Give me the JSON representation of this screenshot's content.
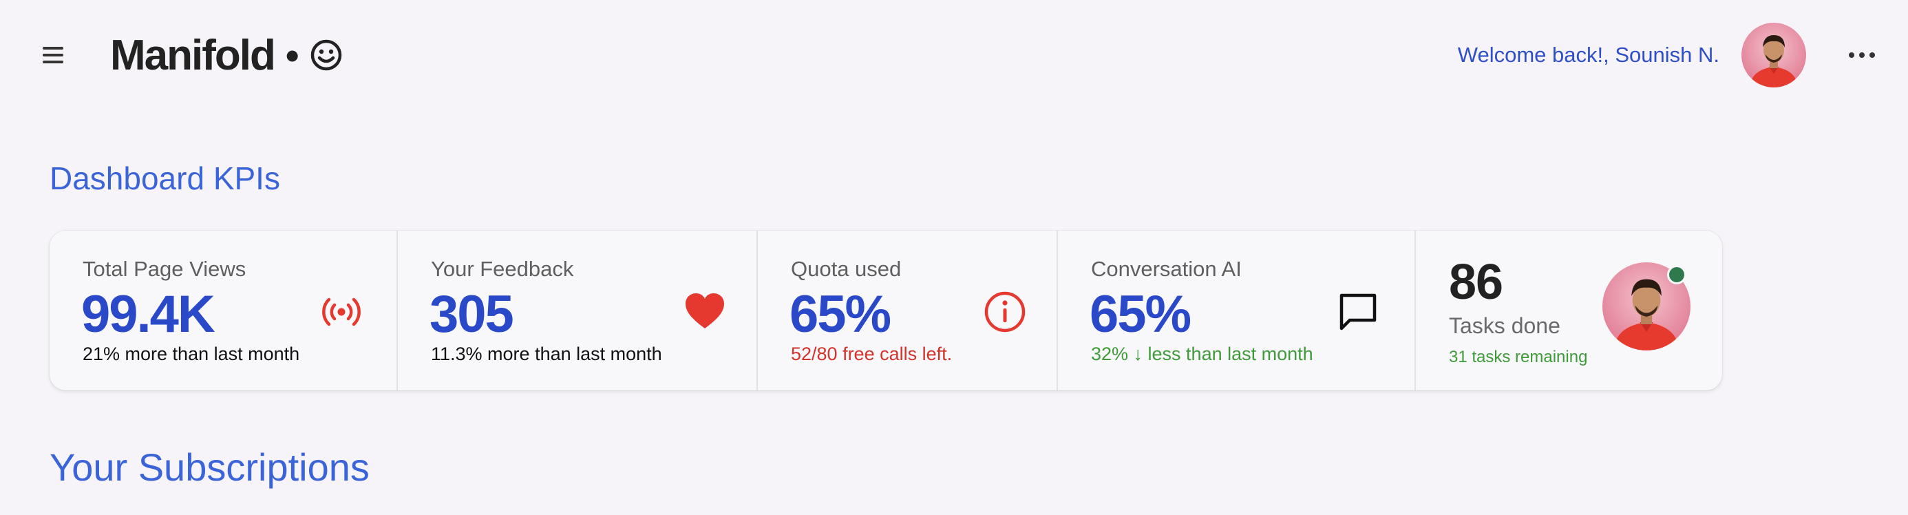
{
  "header": {
    "brand": "Manifold",
    "brand_separator": "•",
    "brand_icon": "smiley-icon",
    "welcome_text": "Welcome back!, Sounish N.",
    "menu_icon": "hamburger-menu-icon",
    "more_icon": "more-horizontal-icon"
  },
  "sections": {
    "kpi_title": "Dashboard KPIs",
    "subscriptions_title": "Your Subscriptions"
  },
  "kpis": [
    {
      "label": "Total Page Views",
      "value": "99.4K",
      "sub": "21% more than last month",
      "icon": "broadcast-icon",
      "icon_color": "#e5392f",
      "sub_color": "#111111"
    },
    {
      "label": "Your Feedback",
      "value": "305",
      "sub": "11.3% more than last month",
      "icon": "heart-icon",
      "icon_color": "#e5392f",
      "sub_color": "#111111"
    },
    {
      "label": "Quota used",
      "value": "65%",
      "sub": "52/80 free calls left.",
      "icon": "info-icon",
      "icon_color": "#e5392f",
      "sub_color": "#d2332b"
    },
    {
      "label": "Conversation AI",
      "value": "65%",
      "sub": "32% ↓ less than last month",
      "icon": "chat-bubble-icon",
      "icon_color": "#111111",
      "sub_color": "#3f9a3a"
    }
  ],
  "tasks": {
    "count": "86",
    "label": "Tasks done",
    "sub": "31 tasks remaining",
    "status_color": "#2f7a4d"
  },
  "colors": {
    "accent": "#2a49c9",
    "title": "#3a64d8",
    "background": "#f6f4f9"
  }
}
